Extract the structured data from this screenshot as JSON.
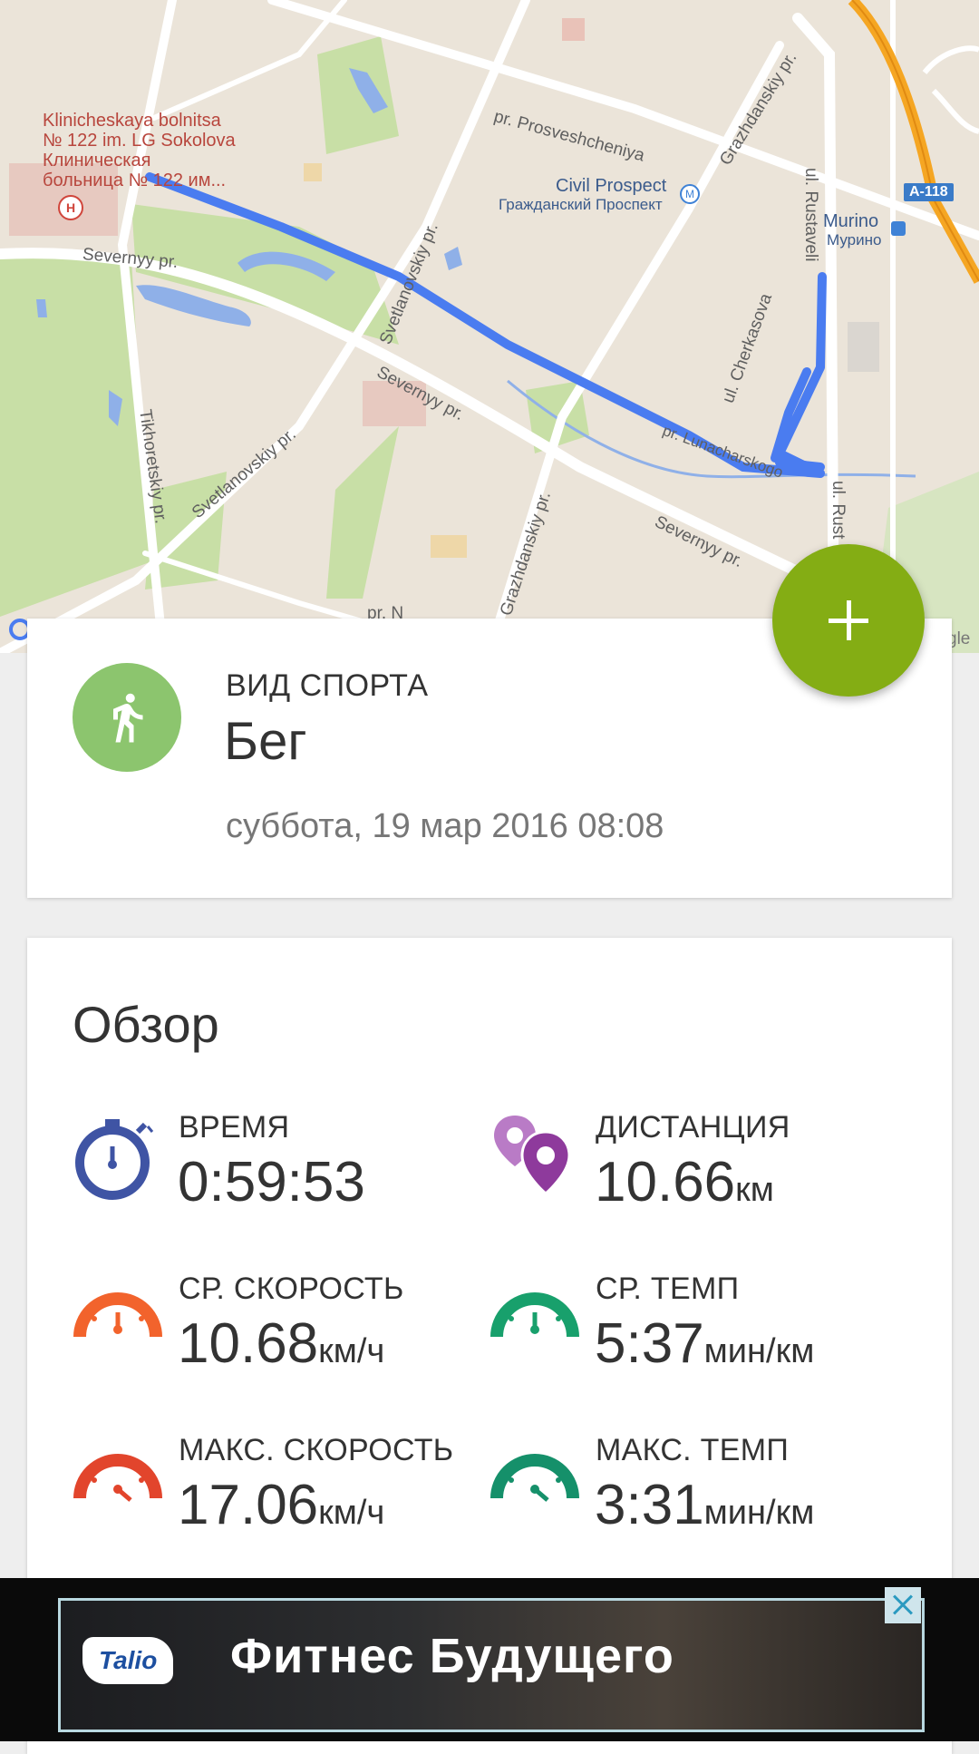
{
  "map": {
    "street_labels": {
      "hospital": "Klinicheskaya bolnitsa\n№ 122 im. LG Sokolova\nКлиническая\nбольница № 122 им...",
      "prosveshcheniya": "pr. Prosveshcheniya",
      "grazhdanskiy_top": "Grazhdanskiy pr.",
      "rustaveli_top": "ul. Rustaveli",
      "civil_prospect": "Civil Prospect",
      "civil_prospect_ru": "Гражданский Проспект",
      "murino": "Murino",
      "murino_ru": "Мурино",
      "severnyy_left": "Severnyy pr.",
      "svetlanovskiy_top": "Svetlanovskiy pr.",
      "cherkasova": "ul. Cherkasova",
      "severnyy_mid": "Severnyy pr.",
      "svetlanovskiy_bottom": "Svetlanovskiy pr.",
      "tikhoretskiy": "Tikhoretskiy pr.",
      "grazhdanskiy_bottom": "Grazhdanskiy pr.",
      "severnyy_right": "Severnyy pr.",
      "rustaveli_bottom": "ul. Rust",
      "lunacharskogo": "pr. Lunacharskogo",
      "pr_n": "pr. N",
      "google_tail": "gle"
    },
    "highway_shield": "A-118",
    "icons": {
      "metro": "metro-icon",
      "bus": "bus-stop-icon",
      "hospital": "hospital-icon"
    },
    "route_color": "#4a7cf0"
  },
  "fab": {
    "icon": "plus-icon",
    "color": "#84ad14"
  },
  "sport_card": {
    "label": "ВИД СПОРТА",
    "value": "Бег",
    "date": "суббота, 19 мар 2016 08:08",
    "icon": "running-icon",
    "icon_bg": "#8cc56e"
  },
  "overview": {
    "title": "Обзор",
    "stats": {
      "time": {
        "label": "ВРЕМЯ",
        "value": "0:59:53",
        "unit": "",
        "icon": "stopwatch-icon",
        "color": "#3f54a4"
      },
      "distance": {
        "label": "ДИСТАНЦИЯ",
        "value": "10.66",
        "unit": "км",
        "icon": "location-pins-icon",
        "color": "#8e3a9c"
      },
      "avg_speed": {
        "label": "СР. СКОРОСТЬ",
        "value": "10.68",
        "unit": "км/ч",
        "icon": "speedometer-icon",
        "color": "#f2632c"
      },
      "avg_pace": {
        "label": "СР. ТЕМП",
        "value": "5:37",
        "unit": "мин/км",
        "icon": "pace-gauge-icon",
        "color": "#18a06c"
      },
      "max_speed": {
        "label": "МАКС. СКОРОСТЬ",
        "value": "17.06",
        "unit": "км/ч",
        "icon": "max-speedometer-icon",
        "color": "#e2452c"
      },
      "max_pace": {
        "label": "МАКС. ТЕМП",
        "value": "3:31",
        "unit": "мин/км",
        "icon": "max-pace-gauge-icon",
        "color": "#15906a"
      }
    }
  },
  "ad": {
    "brand": "Talio",
    "headline": "Фитнес Будущего",
    "close_icon": "close-icon"
  }
}
